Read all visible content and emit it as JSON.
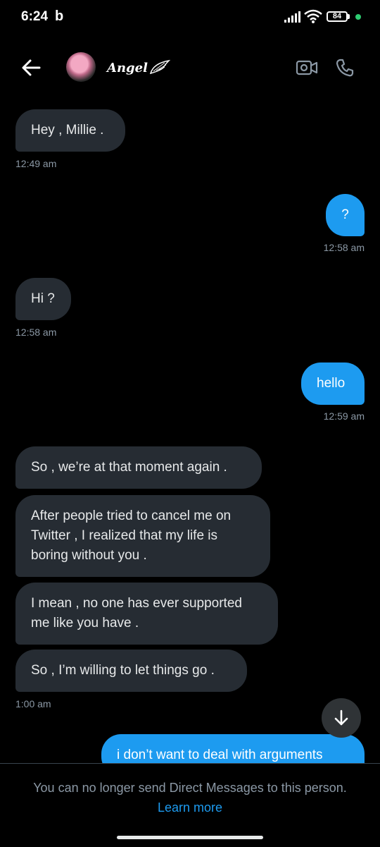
{
  "status_bar": {
    "time": "6:24",
    "carrier_glyph": "b",
    "battery": "84"
  },
  "header": {
    "profile_name": "Angel",
    "icons": [
      "back-arrow-icon",
      "video-call-icon",
      "phone-call-icon",
      "angel-wing-icon"
    ]
  },
  "messages": [
    {
      "direction": "incoming",
      "text": "Hey , Millie .",
      "time": "12:49 am"
    },
    {
      "direction": "outgoing",
      "text": "?",
      "time": "12:58 am"
    },
    {
      "direction": "incoming",
      "text": "Hi ?",
      "time": "12:58 am"
    },
    {
      "direction": "outgoing",
      "text": "hello",
      "time": "12:59 am"
    },
    {
      "direction": "incoming",
      "text": "So , we’re at that moment again ."
    },
    {
      "direction": "incoming",
      "text": "After people tried to cancel me on Twitter , I realized that my life is boring without you ."
    },
    {
      "direction": "incoming",
      "text": "I mean , no one has ever supported me like you have ."
    },
    {
      "direction": "incoming",
      "text": "So , I’m willing to let things go .",
      "time": "1:00 am"
    },
    {
      "direction": "outgoing",
      "text": "i don’t want to deal with arguments"
    }
  ],
  "footer": {
    "notice": "You can no longer send Direct Messages to this person.",
    "link": "Learn more"
  },
  "colors": {
    "background": "#000000",
    "incoming_bubble": "#262c33",
    "outgoing_bubble": "#1d9bf0",
    "link": "#1d9bf0",
    "timestamp": "#8b98a5"
  }
}
